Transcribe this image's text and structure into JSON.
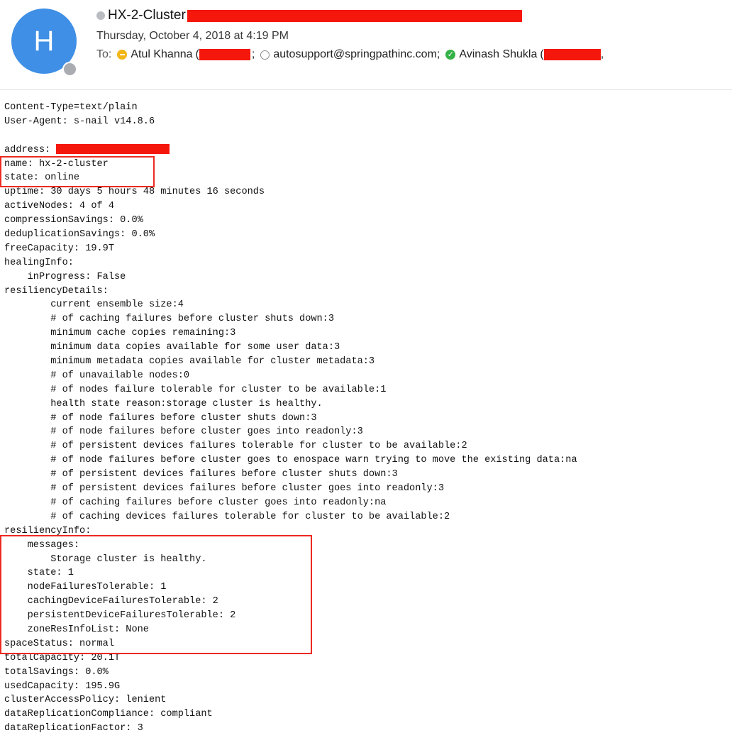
{
  "header": {
    "avatar_initial": "H",
    "subject": "HX-2-Cluster",
    "date": "Thursday, October 4, 2018 at 4:19 PM",
    "to_label": "To:",
    "recipients": [
      {
        "name": "Atul Khanna",
        "status": "away"
      },
      {
        "name": "autosupport@springpathinc.com;",
        "status": "offline"
      },
      {
        "name": "Avinash Shukla",
        "status": "online"
      }
    ]
  },
  "colors": {
    "accent": "#3f8fe6",
    "redaction": "#f5170c",
    "highlight_box": "#ec2a20"
  },
  "body_lines": [
    "Content-Type=text/plain",
    "User-Agent: s-nail v14.8.6",
    "",
    "address: ",
    "name: hx-2-cluster",
    "state: online",
    "uptime: 30 days 5 hours 48 minutes 16 seconds",
    "activeNodes: 4 of 4",
    "compressionSavings: 0.0%",
    "deduplicationSavings: 0.0%",
    "freeCapacity: 19.9T",
    "healingInfo:",
    "    inProgress: False",
    "resiliencyDetails:",
    "        current ensemble size:4",
    "        # of caching failures before cluster shuts down:3",
    "        minimum cache copies remaining:3",
    "        minimum data copies available for some user data:3",
    "        minimum metadata copies available for cluster metadata:3",
    "        # of unavailable nodes:0",
    "        # of nodes failure tolerable for cluster to be available:1",
    "        health state reason:storage cluster is healthy.",
    "        # of node failures before cluster shuts down:3",
    "        # of node failures before cluster goes into readonly:3",
    "        # of persistent devices failures tolerable for cluster to be available:2",
    "        # of node failures before cluster goes to enospace warn trying to move the existing data:na",
    "        # of persistent devices failures before cluster shuts down:3",
    "        # of persistent devices failures before cluster goes into readonly:3",
    "        # of caching failures before cluster goes into readonly:na",
    "        # of caching devices failures tolerable for cluster to be available:2",
    "resiliencyInfo:",
    "    messages:",
    "        Storage cluster is healthy.",
    "    state: 1",
    "    nodeFailuresTolerable: 1",
    "    cachingDeviceFailuresTolerable: 2",
    "    persistentDeviceFailuresTolerable: 2",
    "    zoneResInfoList: None",
    "spaceStatus: normal",
    "totalCapacity: 20.1T",
    "totalSavings: 0.0%",
    "usedCapacity: 195.9G",
    "clusterAccessPolicy: lenient",
    "dataReplicationCompliance: compliant",
    "dataReplicationFactor: 3"
  ]
}
